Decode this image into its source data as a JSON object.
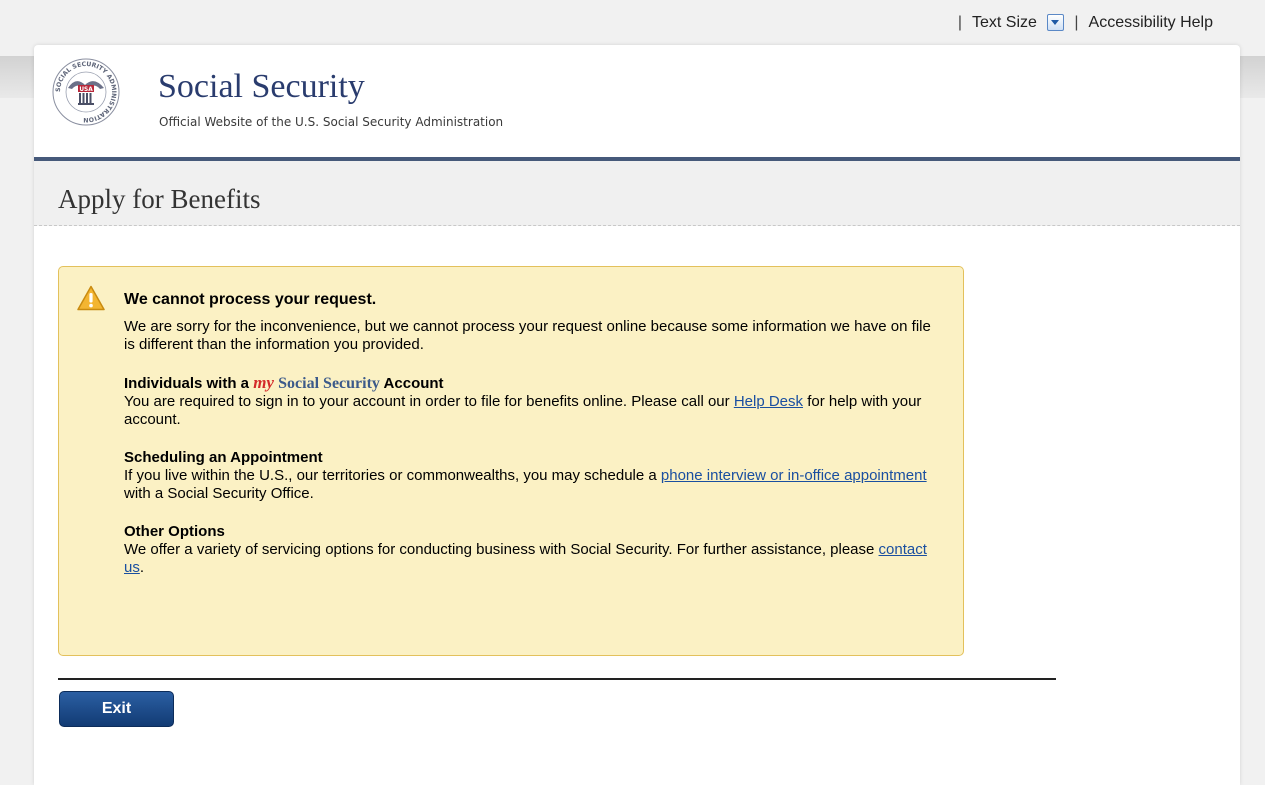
{
  "utility": {
    "text_size_label": "Text Size",
    "accessibility_label": "Accessibility Help"
  },
  "header": {
    "seal_text": "SOCIAL SECURITY ADMINISTRATION",
    "seal_usa": "USA",
    "title": "Social Security",
    "tagline": "Official Website of the U.S. Social Security Administration"
  },
  "page": {
    "title": "Apply for Benefits"
  },
  "alert": {
    "title": "We cannot process your request.",
    "intro": "We are sorry for the inconvenience, but we cannot process your request online because some information we have on file is different than the information you provided.",
    "account_heading_prefix": "Individuals with a",
    "account_heading_my": "my",
    "account_heading_ss": "Social Security",
    "account_heading_suffix": "Account",
    "account_text": "You are required to sign in to your account in order to file for benefits online.  Please call our",
    "help_desk_link": "Help Desk",
    "account_text_after": "for help with your account.",
    "schedule_heading": "Scheduling an Appointment",
    "schedule_text": "If you live within the U.S., our territories or commonwealths, you may schedule a",
    "schedule_link": "phone interview or in-office appointment",
    "schedule_text_after": "with a Social Security Office.",
    "other_heading": "Other Options",
    "other_text": "We offer a variety of servicing options for conducting business with Social Security.  For further assistance, please",
    "contact_link": "contact us",
    "other_text_after": "."
  },
  "actions": {
    "exit_label": "Exit"
  },
  "colors": {
    "brand_navy": "#2a3c6e",
    "alert_bg": "#fbf1c4",
    "alert_border": "#e3c15c",
    "link": "#1a4fa0",
    "button": "#1b4582"
  }
}
